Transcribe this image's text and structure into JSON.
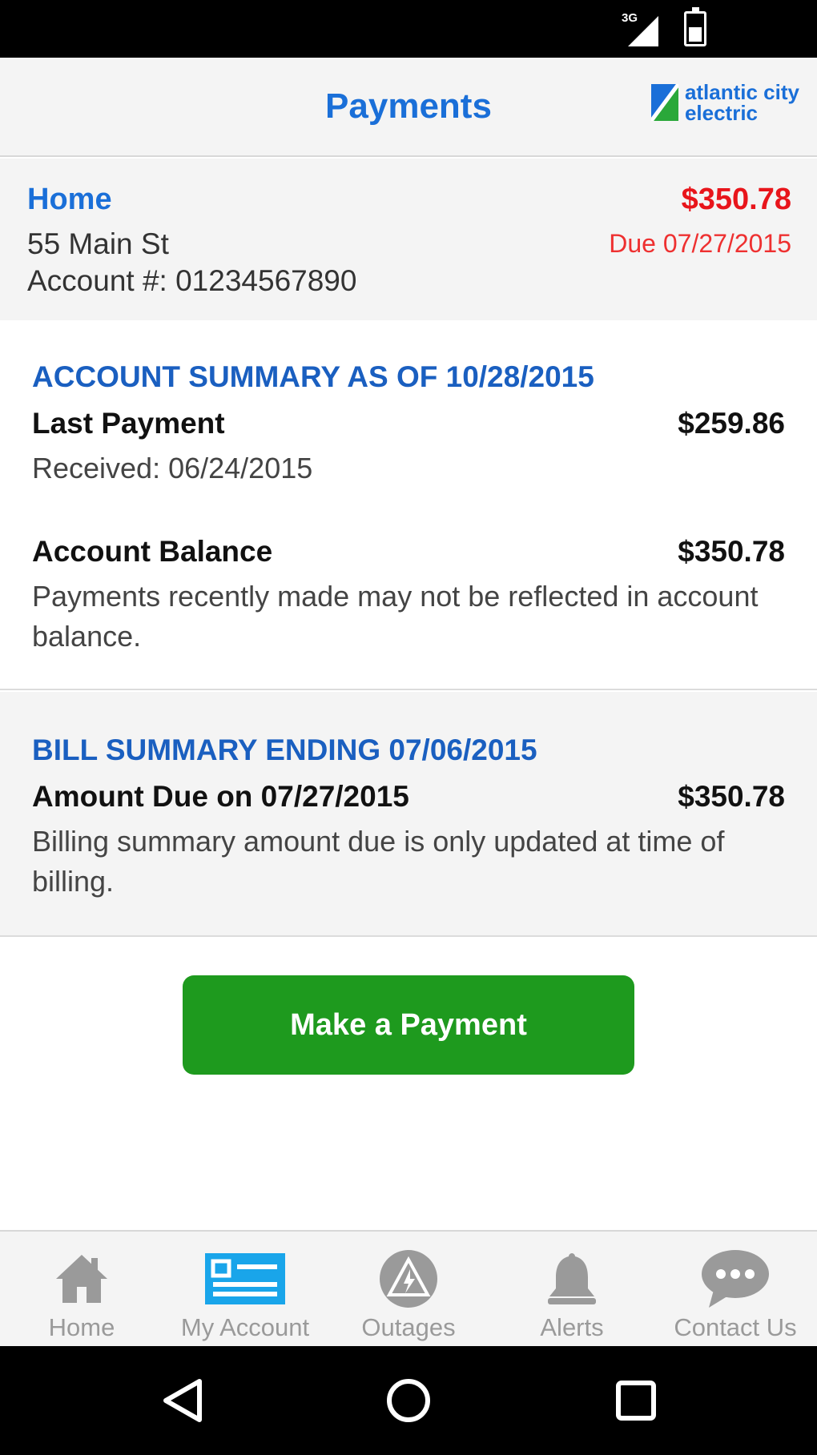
{
  "app": {
    "title": "Payments",
    "brand_line1": "atlantic city",
    "brand_line2": "electric"
  },
  "account": {
    "name": "Home",
    "address": "55 Main St",
    "number": "Account #: 01234567890",
    "amount": "$350.78",
    "due": "Due 07/27/2015"
  },
  "account_summary": {
    "title": "ACCOUNT SUMMARY AS OF 10/28/2015",
    "last_payment_label": "Last Payment",
    "last_payment_value": "$259.86",
    "received": "Received: 06/24/2015",
    "balance_label": "Account Balance",
    "balance_value": "$350.78",
    "balance_note": "Payments recently made may not be reflected in account balance."
  },
  "bill_summary": {
    "title": "BILL SUMMARY ENDING 07/06/2015",
    "amount_due_label": "Amount Due on 07/27/2015",
    "amount_due_value": "$350.78",
    "note": "Billing summary amount due is only updated at time of billing."
  },
  "actions": {
    "make_payment": "Make a Payment"
  },
  "status_bar": {
    "network": "3G"
  },
  "bottom_nav": {
    "items": [
      {
        "label": "Home",
        "icon": "home-icon"
      },
      {
        "label": "My Account",
        "icon": "account-card-icon",
        "active": true
      },
      {
        "label": "Outages",
        "icon": "outage-icon"
      },
      {
        "label": "Alerts",
        "icon": "bell-icon"
      },
      {
        "label": "Contact Us",
        "icon": "chat-icon"
      }
    ]
  },
  "colors": {
    "accent": "#1a6fd8",
    "section_title": "#1a5fc0",
    "amount_red": "#e8151b",
    "pay_green": "#1e9a1e",
    "nav_active": "#19a5ea",
    "nav_inactive": "#9a9a9a"
  }
}
